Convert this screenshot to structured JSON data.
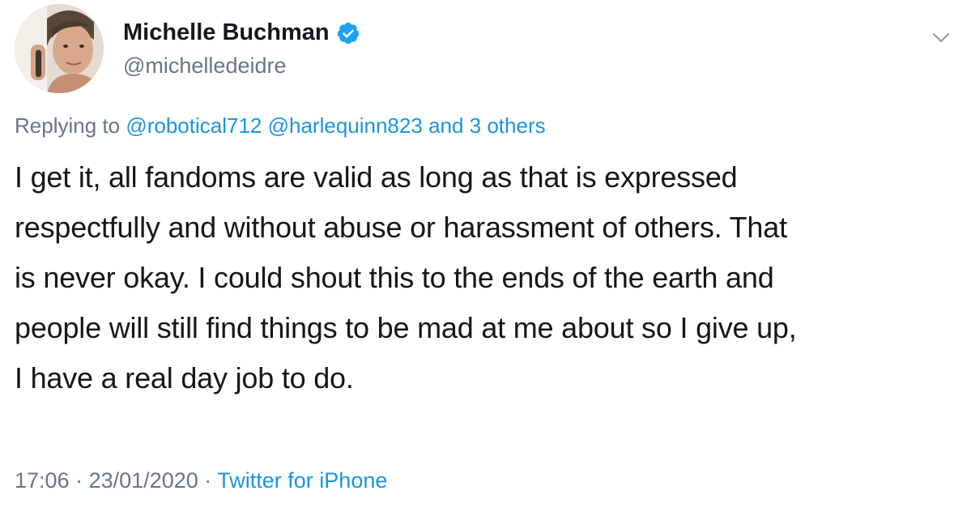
{
  "author": {
    "display_name": "Michelle Buchman",
    "handle": "@michelledeidre",
    "verified": true,
    "avatar_icon": "profile-photo-avatar"
  },
  "reply": {
    "prefix": "Replying to",
    "mentions": [
      "@robotical712",
      "@harlequinn823"
    ],
    "others": "and 3 others"
  },
  "tweet": {
    "lines": [
      "I get it, all fandoms are valid as long as that is expressed",
      "respectfully and without abuse or harassment of others. That",
      "is never okay. I could shout this to the ends of the earth and",
      "people will still find things to be mad at me about so I give up,",
      "I have a real day job to do."
    ]
  },
  "meta": {
    "time": "17:06",
    "separator": "·",
    "date": "23/01/2020",
    "source": "Twitter for iPhone"
  },
  "colors": {
    "text": "#14171a",
    "secondary": "#657786",
    "link": "#1b95e0",
    "verified": "#1da1f2"
  }
}
